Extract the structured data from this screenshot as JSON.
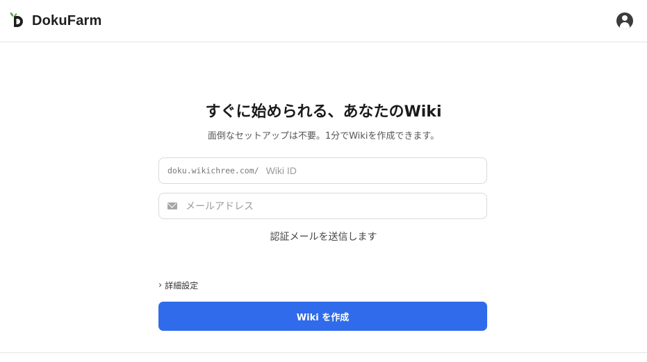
{
  "header": {
    "brand_name": "DokuFarm",
    "logo_letter": "D",
    "account_icon": "user-circle-icon"
  },
  "hero": {
    "title": "すぐに始められる、あなたのWiki",
    "subtitle": "面倒なセットアップは不要。1分でWikiを作成できます。"
  },
  "form": {
    "wiki_id": {
      "prefix": "doku.wikichree.com/",
      "placeholder": "Wiki ID",
      "value": ""
    },
    "email": {
      "icon": "envelope-icon",
      "placeholder": "メールアドレス",
      "value": ""
    },
    "notice": "認証メールを送信します",
    "advanced_label": "詳細設定",
    "advanced_chevron": "›",
    "submit_label": "Wiki を作成"
  },
  "colors": {
    "primary": "#2f6bea",
    "logo_green": "#5aa84a",
    "text_dark": "#1a1a1a"
  }
}
